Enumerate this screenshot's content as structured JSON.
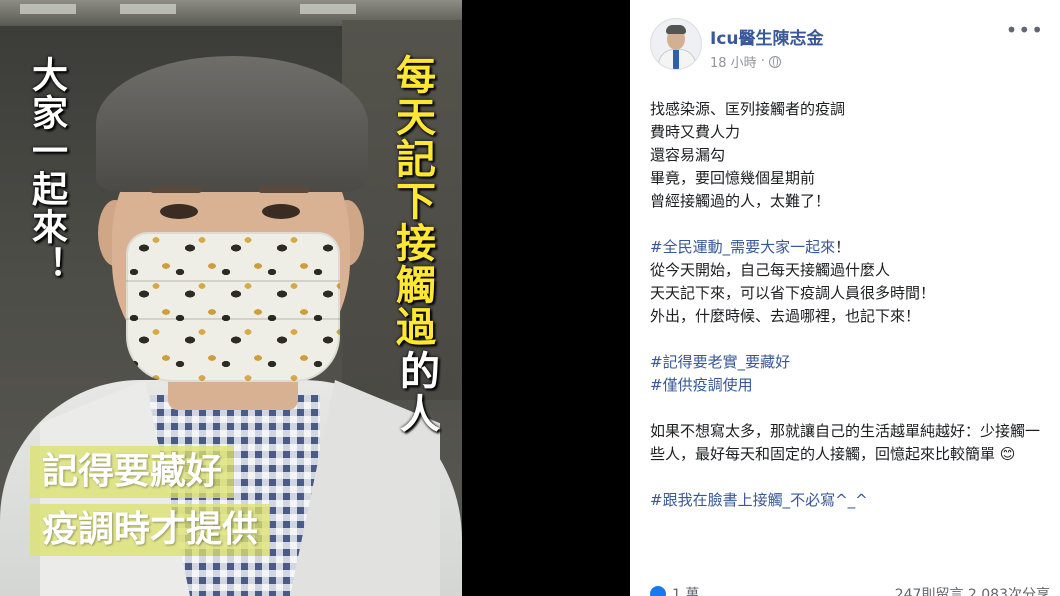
{
  "photo": {
    "left_vertical_text": "大家一起來！",
    "right_vertical_text_yellow": "每天記下接觸過",
    "right_vertical_text_white": "的人",
    "caption_line1": "記得要藏好",
    "caption_line2": "疫調時才提供"
  },
  "post": {
    "author": "Icu醫生陳志金",
    "time": "18 小時",
    "more_label": "•••",
    "lines": [
      "找感染源、匡列接觸者的疫調",
      "費時又費人力",
      "還容易漏勾",
      "畢竟，要回憶幾個星期前",
      "曾經接觸過的人，太難了！"
    ],
    "hashtag1": "#全民運動_需要大家一起來",
    "hashtag1_suffix": "！",
    "lines2": [
      "從今天開始，自己每天接觸過什麼人",
      "天天記下來，可以省下疫調人員很多時間！",
      "外出，什麼時候、去過哪裡，也記下來！"
    ],
    "hashtag2": "#記得要老實_要藏好",
    "hashtag3": "#僅供疫調使用",
    "paragraph": "如果不想寫太多，那就讓自己的生活越單純越好：少接觸一些人，最好每天和固定的人接觸，回憶起來比較簡單 😊",
    "hashtag4": "#跟我在臉書上接觸_不必寫^_^",
    "reactions": "1 萬",
    "stats": "247則留言 2,083次分享"
  }
}
